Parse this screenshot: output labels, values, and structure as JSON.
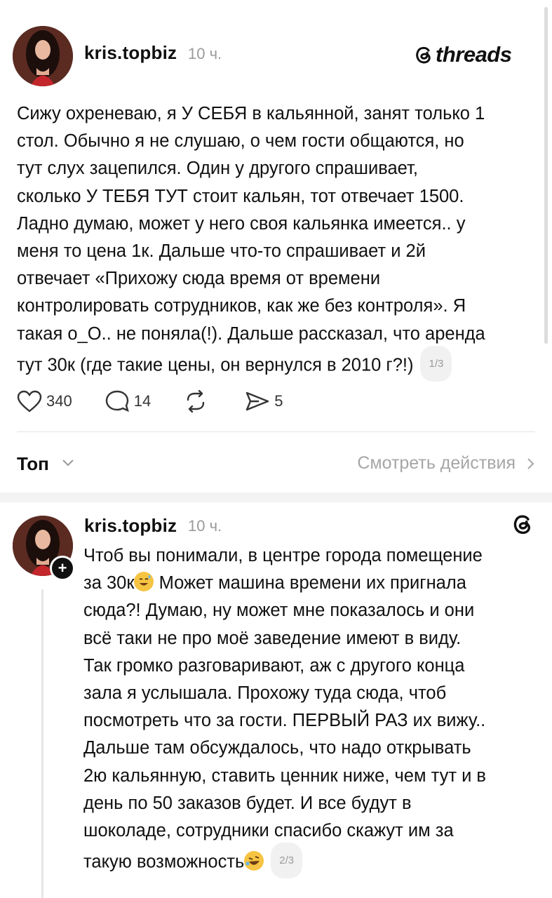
{
  "brand": {
    "wordmark": "threads"
  },
  "posts": [
    {
      "username": "kris.topbiz",
      "time": "10 ч.",
      "text": "Сижу охреневаю, я У СЕБЯ в кальянной, занят только 1\nстол. Обычно я не слушаю, о чем гости общаются, но\nтут слух зацепился. Один у другого спрашивает,\nсколько У ТЕБЯ ТУТ стоит кальян, тот отвечает 1500.\nЛадно думаю, может у него своя кальянка имеется.. у\nменя то цена 1к. Дальше что-то спрашивает и 2й\nотвечает «Прихожу сюда время от времени\nконтролировать сотрудников, как же без контроля». Я\nтакая о_О.. не поняла(!). Дальше рассказал, что аренда\nтут 30к (где такие цены, он вернулся в 2010 г?!)",
      "pager": "1/3",
      "likes": "340",
      "comments": "14",
      "shares": "5"
    },
    {
      "username": "kris.topbiz",
      "time": "10 ч.",
      "text_a": "Чтоб вы понимали, в центре города помещение\nза 30к",
      "text_b": " Может машина времени их пригнала\nсюда?! Думаю, ну может мне показалось и они\nвсё таки не про моё заведение имеют в виду.\nТак громко разговаривают, аж с другого конца\nзала я услышала. Прохожу туда сюда, чтоб\nпосмотреть что за гости. ПЕРВЫЙ РАЗ их вижу..\nДальше там обсуждалось, что надо открывать\n2ю кальянную, ставить ценник ниже, чем тут и в\nдень по 50 заказов будет. И все будут в\nшоколаде, сотрудники спасибо скажут им за\nтакую возможность",
      "pager": "2/3",
      "plus": "+"
    }
  ],
  "sort": {
    "label": "Топ",
    "view_activity": "Смотреть действия"
  },
  "colors": {
    "text": "#101010",
    "muted": "#9a9a9a",
    "divider": "#e3e3e3"
  }
}
